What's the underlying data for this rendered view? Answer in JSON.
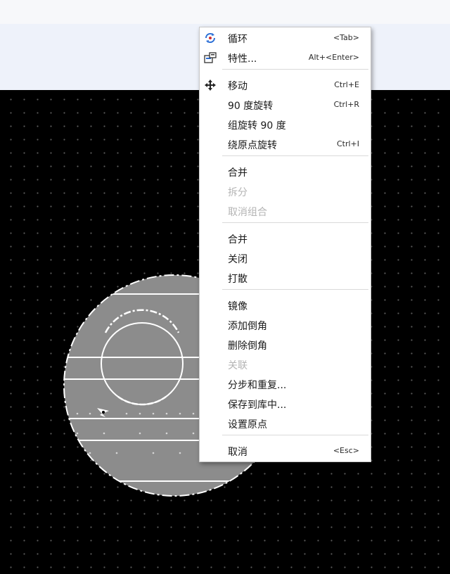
{
  "colors": {
    "canvas_background": "#000000",
    "grid_dot": "#5a5a5a",
    "shape_fill": "#8c8c8c",
    "menu_background": "#ffffff",
    "icon_blue": "#2b6fd6",
    "disabled_text": "#b4b4b4"
  },
  "context_menu": {
    "groups": [
      [
        {
          "label": "循环",
          "shortcut": "<Tab>",
          "icon": "cycle-icon",
          "enabled": true
        },
        {
          "label": "特性...",
          "shortcut": "Alt+<Enter>",
          "icon": "properties-icon",
          "enabled": true
        }
      ],
      [
        {
          "label": "移动",
          "shortcut": "Ctrl+E",
          "icon": "move-icon",
          "enabled": true
        },
        {
          "label": "90 度旋转",
          "shortcut": "Ctrl+R",
          "icon": "",
          "enabled": true
        },
        {
          "label": "组旋转 90 度",
          "shortcut": "",
          "icon": "",
          "enabled": true
        },
        {
          "label": "绕原点旋转",
          "shortcut": "Ctrl+I",
          "icon": "",
          "enabled": true
        }
      ],
      [
        {
          "label": "合并",
          "shortcut": "",
          "icon": "",
          "enabled": true
        },
        {
          "label": "拆分",
          "shortcut": "",
          "icon": "",
          "enabled": false
        },
        {
          "label": "取消组合",
          "shortcut": "",
          "icon": "",
          "enabled": false
        }
      ],
      [
        {
          "label": "合并",
          "shortcut": "",
          "icon": "",
          "enabled": true
        },
        {
          "label": "关闭",
          "shortcut": "",
          "icon": "",
          "enabled": true
        },
        {
          "label": "打散",
          "shortcut": "",
          "icon": "",
          "enabled": true
        }
      ],
      [
        {
          "label": "镜像",
          "shortcut": "",
          "icon": "",
          "enabled": true
        },
        {
          "label": "添加倒角",
          "shortcut": "",
          "icon": "",
          "enabled": true
        },
        {
          "label": "删除倒角",
          "shortcut": "",
          "icon": "",
          "enabled": true
        },
        {
          "label": "关联",
          "shortcut": "",
          "icon": "",
          "enabled": false
        },
        {
          "label": "分步和重复...",
          "shortcut": "",
          "icon": "",
          "enabled": true
        },
        {
          "label": "保存到库中...",
          "shortcut": "",
          "icon": "",
          "enabled": true
        },
        {
          "label": "设置原点",
          "shortcut": "",
          "icon": "",
          "enabled": true
        }
      ],
      [
        {
          "label": "取消",
          "shortcut": "<Esc>",
          "icon": "",
          "enabled": true
        }
      ]
    ]
  }
}
